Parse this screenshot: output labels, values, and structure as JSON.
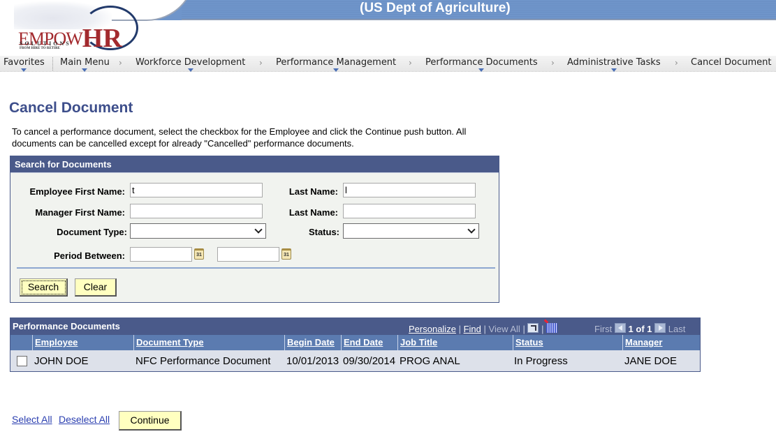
{
  "header": {
    "org_title": "(US Dept of Agriculture)",
    "logo": {
      "name_part1": "EMPOW",
      "name_part2": "HR",
      "subtitle": "SOLUTIONS",
      "tagline": "FROM HIRE TO RETIRE"
    }
  },
  "nav": {
    "items": [
      {
        "label": "Favorites",
        "has_menu": true
      },
      {
        "label": "Main Menu",
        "has_menu": true
      },
      {
        "label": "Workforce Development",
        "has_menu": true
      },
      {
        "label": "Performance Management",
        "has_menu": true
      },
      {
        "label": "Performance Documents",
        "has_menu": true
      },
      {
        "label": "Administrative Tasks",
        "has_menu": true
      },
      {
        "label": "Cancel Document",
        "has_menu": false
      }
    ],
    "separator": "›"
  },
  "page": {
    "title": "Cancel Document",
    "instructions": "To cancel a performance document, select the checkbox for the Employee and click the Continue push button. All documents can be cancelled except for already \"Cancelled\" performance documents."
  },
  "search": {
    "header": "Search for Documents",
    "employee_first_name": {
      "label": "Employee First Name:",
      "value": "t"
    },
    "employee_last_name": {
      "label": "Last Name:",
      "value": "l"
    },
    "manager_first_name": {
      "label": "Manager First Name:",
      "value": ""
    },
    "manager_last_name": {
      "label": "Last Name:",
      "value": ""
    },
    "document_type": {
      "label": "Document Type:",
      "value": ""
    },
    "status": {
      "label": "Status:",
      "value": ""
    },
    "period_between": {
      "label": "Period Between:",
      "from": "",
      "to": "",
      "calendar_icon_text": "31"
    },
    "search_button": "Search",
    "clear_button": "Clear"
  },
  "results": {
    "title": "Performance Documents",
    "tools": {
      "personalize": "Personalize",
      "find": "Find",
      "view_all": "View All",
      "separator": "|",
      "first": "First",
      "page_info": "1 of 1",
      "last": "Last"
    },
    "columns": [
      "Employee",
      "Document Type",
      "Begin Date",
      "End Date",
      "Job Title",
      "Status",
      "Manager"
    ],
    "rows": [
      {
        "checked": false,
        "employee": "JOHN DOE",
        "document_type": "NFC Performance Document",
        "begin_date": "10/01/2013",
        "end_date": "09/30/2014",
        "job_title": "PROG ANAL",
        "status": "In Progress",
        "manager": "JANE DOE"
      }
    ]
  },
  "footer": {
    "select_all": "Select All",
    "deselect_all": "Deselect All",
    "continue_button": "Continue"
  },
  "colors": {
    "header_band": "#6f95ca",
    "panel_header": "#4a5a8a",
    "column_header": "#5b7bb0",
    "row_background": "#dde1ea",
    "button_background": "#ffffc0",
    "page_title": "#3d4e8b",
    "link": "#2b3fb0"
  }
}
